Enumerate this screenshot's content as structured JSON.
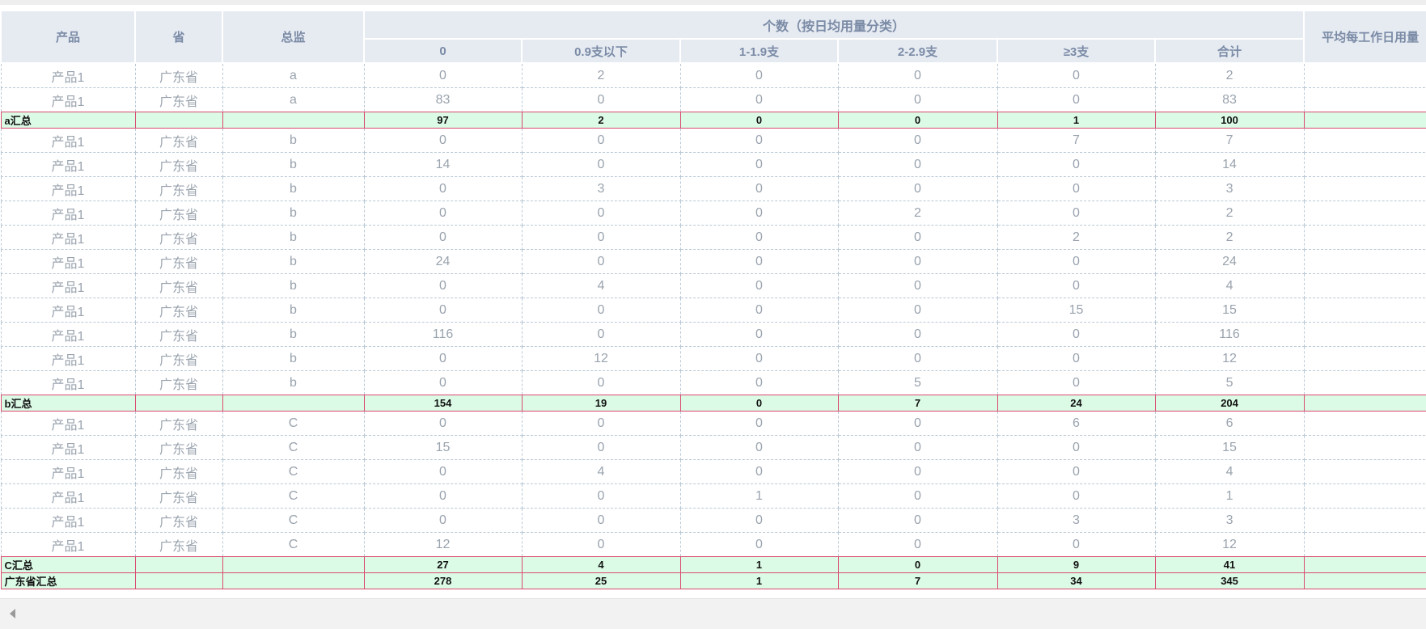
{
  "table": {
    "headers": {
      "product": "产品",
      "province": "省",
      "director": "总监",
      "count_group": "个数（按日均用量分类）",
      "columns": [
        "0",
        "0.9支以下",
        "1-1.9支",
        "2-2.9支",
        "≥3支",
        "合计"
      ],
      "avg_per_workday": "平均每工作日用量"
    },
    "groups": [
      {
        "rows": [
          [
            "产品1",
            "广东省",
            "a",
            "0",
            "2",
            "0",
            "0",
            "0",
            "2",
            ""
          ],
          [
            "产品1",
            "广东省",
            "a",
            "83",
            "0",
            "0",
            "0",
            "0",
            "83",
            ""
          ]
        ],
        "subtotal": [
          "a汇总",
          "",
          "",
          "97",
          "2",
          "0",
          "0",
          "1",
          "100",
          ""
        ]
      },
      {
        "rows": [
          [
            "产品1",
            "广东省",
            "b",
            "0",
            "0",
            "0",
            "0",
            "7",
            "7",
            ""
          ],
          [
            "产品1",
            "广东省",
            "b",
            "14",
            "0",
            "0",
            "0",
            "0",
            "14",
            ""
          ],
          [
            "产品1",
            "广东省",
            "b",
            "0",
            "3",
            "0",
            "0",
            "0",
            "3",
            ""
          ],
          [
            "产品1",
            "广东省",
            "b",
            "0",
            "0",
            "0",
            "2",
            "0",
            "2",
            ""
          ],
          [
            "产品1",
            "广东省",
            "b",
            "0",
            "0",
            "0",
            "0",
            "2",
            "2",
            ""
          ],
          [
            "产品1",
            "广东省",
            "b",
            "24",
            "0",
            "0",
            "0",
            "0",
            "24",
            ""
          ],
          [
            "产品1",
            "广东省",
            "b",
            "0",
            "4",
            "0",
            "0",
            "0",
            "4",
            ""
          ],
          [
            "产品1",
            "广东省",
            "b",
            "0",
            "0",
            "0",
            "0",
            "15",
            "15",
            ""
          ],
          [
            "产品1",
            "广东省",
            "b",
            "116",
            "0",
            "0",
            "0",
            "0",
            "116",
            ""
          ],
          [
            "产品1",
            "广东省",
            "b",
            "0",
            "12",
            "0",
            "0",
            "0",
            "12",
            ""
          ],
          [
            "产品1",
            "广东省",
            "b",
            "0",
            "0",
            "0",
            "5",
            "0",
            "5",
            ""
          ]
        ],
        "subtotal": [
          "b汇总",
          "",
          "",
          "154",
          "19",
          "0",
          "7",
          "24",
          "204",
          ""
        ]
      },
      {
        "rows": [
          [
            "产品1",
            "广东省",
            "C",
            "0",
            "0",
            "0",
            "0",
            "6",
            "6",
            ""
          ],
          [
            "产品1",
            "广东省",
            "C",
            "15",
            "0",
            "0",
            "0",
            "0",
            "15",
            ""
          ],
          [
            "产品1",
            "广东省",
            "C",
            "0",
            "4",
            "0",
            "0",
            "0",
            "4",
            ""
          ],
          [
            "产品1",
            "广东省",
            "C",
            "0",
            "0",
            "1",
            "0",
            "0",
            "1",
            ""
          ],
          [
            "产品1",
            "广东省",
            "C",
            "0",
            "0",
            "0",
            "0",
            "3",
            "3",
            ""
          ],
          [
            "产品1",
            "广东省",
            "C",
            "12",
            "0",
            "0",
            "0",
            "0",
            "12",
            ""
          ]
        ],
        "subtotal": [
          "C汇总",
          "",
          "",
          "27",
          "4",
          "1",
          "0",
          "9",
          "41",
          ""
        ]
      }
    ],
    "grand_total": [
      "广东省汇总",
      "",
      "",
      "278",
      "25",
      "1",
      "7",
      "34",
      "345",
      ""
    ]
  },
  "scrollbar": {
    "left_arrow_icon": "caret-left-icon"
  }
}
